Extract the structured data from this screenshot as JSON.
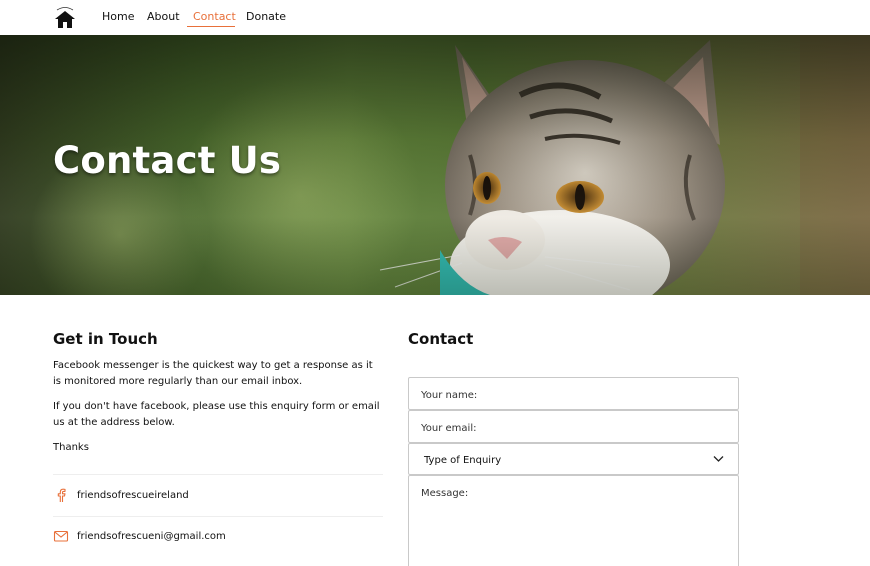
{
  "nav": {
    "items": [
      {
        "label": "Home"
      },
      {
        "label": "About"
      },
      {
        "label": "Contact",
        "active": true
      },
      {
        "label": "Donate"
      }
    ],
    "logo_icon": "house-logo-icon",
    "accent_color": "#e8703a"
  },
  "hero": {
    "title": "Contact Us"
  },
  "get_in_touch": {
    "heading": "Get in Touch",
    "paragraph1": "Facebook messenger is the quickest way to get a response as it is monitored more regularly than our email inbox.",
    "paragraph2": "If you don't have facebook, please use this enquiry form or email us at the address below.",
    "paragraph3": "Thanks",
    "facebook": {
      "icon": "facebook-icon",
      "text": "friendsofrescueireland"
    },
    "email": {
      "icon": "mail-icon",
      "text": "friendsofrescueni@gmail.com"
    }
  },
  "contact_form": {
    "heading": "Contact",
    "name_placeholder": "Your name:",
    "email_placeholder": "Your email:",
    "enquiry_type_selected": "Type of Enquiry",
    "message_placeholder": "Message:"
  }
}
